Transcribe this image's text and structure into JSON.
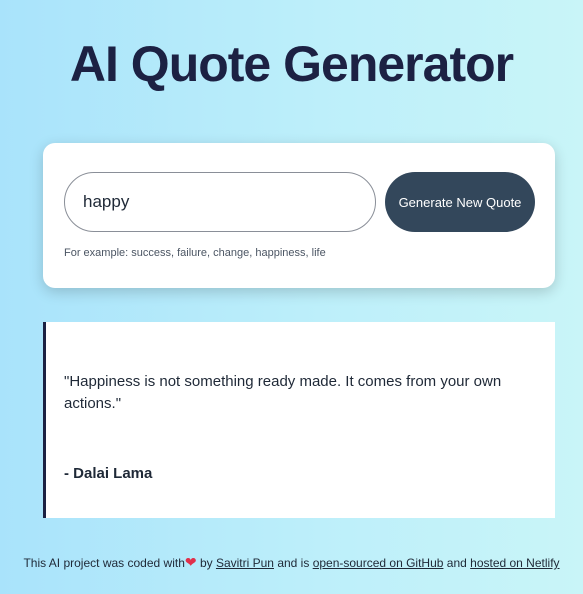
{
  "header": {
    "title": "AI Quote Generator"
  },
  "search": {
    "value": "happy",
    "button_label": "Generate New Quote",
    "hint": "For example: success, failure, change, happiness, life"
  },
  "quote": {
    "text": "\"Happiness is not something ready made. It comes from your own actions.\"",
    "author": "- Dalai Lama"
  },
  "footer": {
    "prefix": "This AI project was coded with",
    "heart": "❤",
    "by": " by ",
    "author_link": "Savitri Pun",
    "and_is": " and is ",
    "github_link": "open-sourced on GitHub",
    "and": " and ",
    "netlify_link": "hosted on Netlify"
  },
  "colors": {
    "title": "#1c2143",
    "button": "#33475b",
    "heart": "#e0304a"
  }
}
